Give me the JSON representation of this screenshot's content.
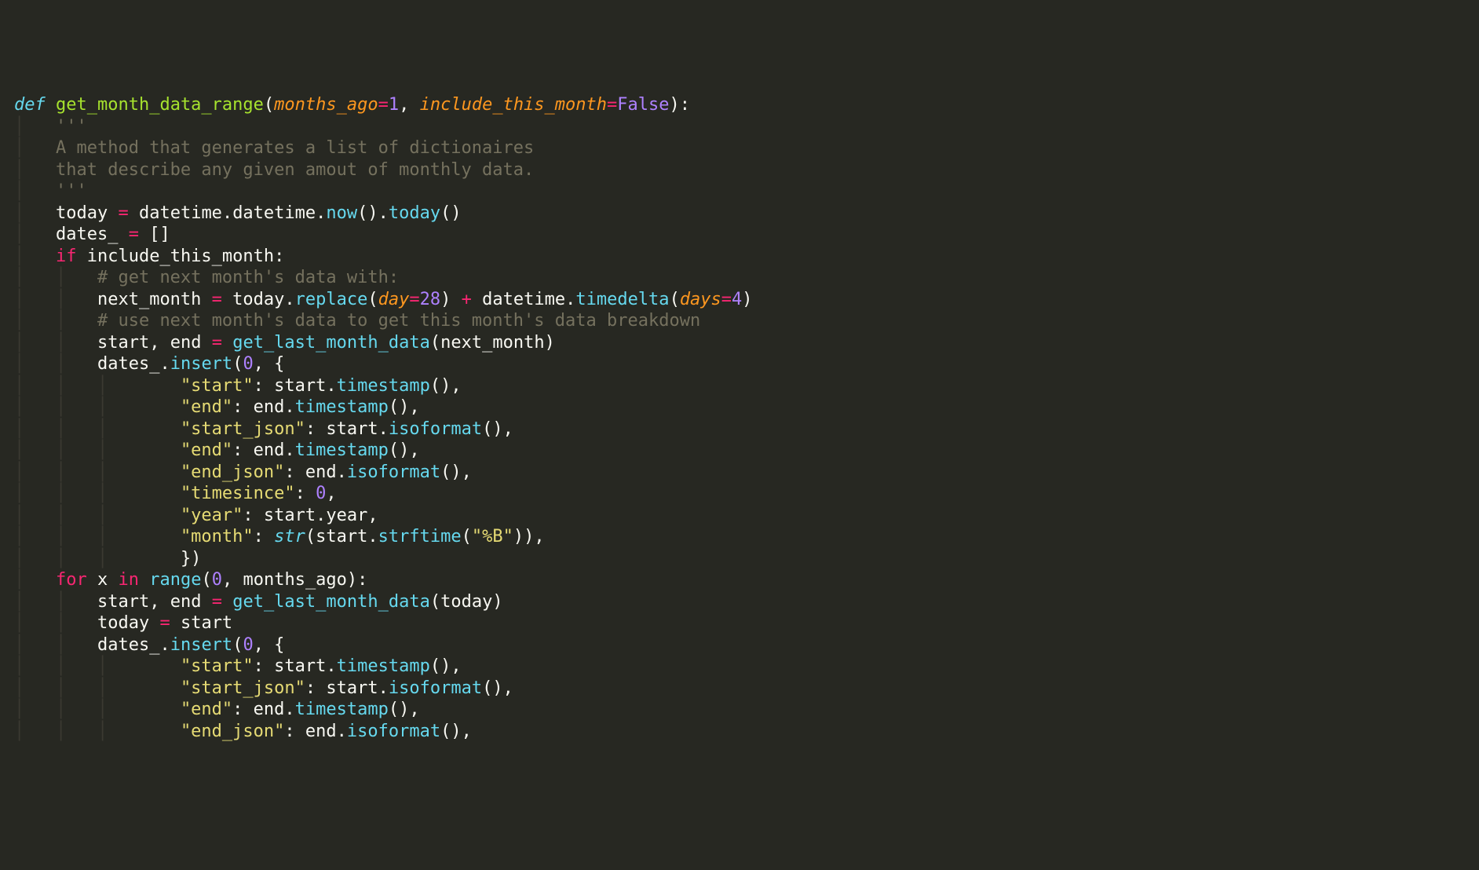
{
  "code": {
    "l1_def": "def",
    "l1_fn": "get_month_data_range",
    "l1_p1": "months_ago",
    "l1_v1": "1",
    "l1_p2": "include_this_month",
    "l1_v2": "False",
    "l2_doc": "'''",
    "l3_doc": "A method that generates a list of dictionaires",
    "l4_doc": "that describe any given amout of monthly data.",
    "l5_doc": "'''",
    "l6_today": "today",
    "l6_dt1": "datetime",
    "l6_dt2": "datetime",
    "l6_now": "now",
    "l6_today2": "today",
    "l7_dates": "dates_",
    "l8_if": "if",
    "l8_inc": "include_this_month",
    "l9_comment": "# get next month's data with:",
    "l10_nm": "next_month",
    "l10_today": "today",
    "l10_replace": "replace",
    "l10_day": "day",
    "l10_28": "28",
    "l10_dt": "datetime",
    "l10_td": "timedelta",
    "l10_days": "days",
    "l10_4": "4",
    "l11_comment": "# use next month's data to get this month's data breakdown",
    "l12_start": "start",
    "l12_end": "end",
    "l12_glmd": "get_last_month_data",
    "l12_nm": "next_month",
    "l13_dates": "dates_",
    "l13_insert": "insert",
    "l13_0": "0",
    "l14_k": "\"start\"",
    "l14_start": "start",
    "l14_ts": "timestamp",
    "l15_k": "\"end\"",
    "l15_end": "end",
    "l15_ts": "timestamp",
    "l16_k": "\"start_json\"",
    "l16_start": "start",
    "l16_iso": "isoformat",
    "l17_k": "\"end\"",
    "l17_end": "end",
    "l17_ts": "timestamp",
    "l18_k": "\"end_json\"",
    "l18_end": "end",
    "l18_iso": "isoformat",
    "l19_k": "\"timesince\"",
    "l19_0": "0",
    "l20_k": "\"year\"",
    "l20_start": "start",
    "l20_year": "year",
    "l21_k": "\"month\"",
    "l21_str": "str",
    "l21_start": "start",
    "l21_strf": "strftime",
    "l21_fmt": "\"%B\"",
    "l23_for": "for",
    "l23_x": "x",
    "l23_in": "in",
    "l23_range": "range",
    "l23_0": "0",
    "l23_ma": "months_ago",
    "l24_start": "start",
    "l24_end": "end",
    "l24_glmd": "get_last_month_data",
    "l24_today": "today",
    "l25_today": "today",
    "l25_start": "start",
    "l26_dates": "dates_",
    "l26_insert": "insert",
    "l26_0": "0",
    "l27_k": "\"start\"",
    "l27_start": "start",
    "l27_ts": "timestamp",
    "l28_k": "\"start_json\"",
    "l28_start": "start",
    "l28_iso": "isoformat",
    "l29_k": "\"end\"",
    "l29_end": "end",
    "l29_ts": "timestamp",
    "l30_k": "\"end_json\"",
    "l30_end": "end",
    "l30_iso": "isoformat"
  }
}
